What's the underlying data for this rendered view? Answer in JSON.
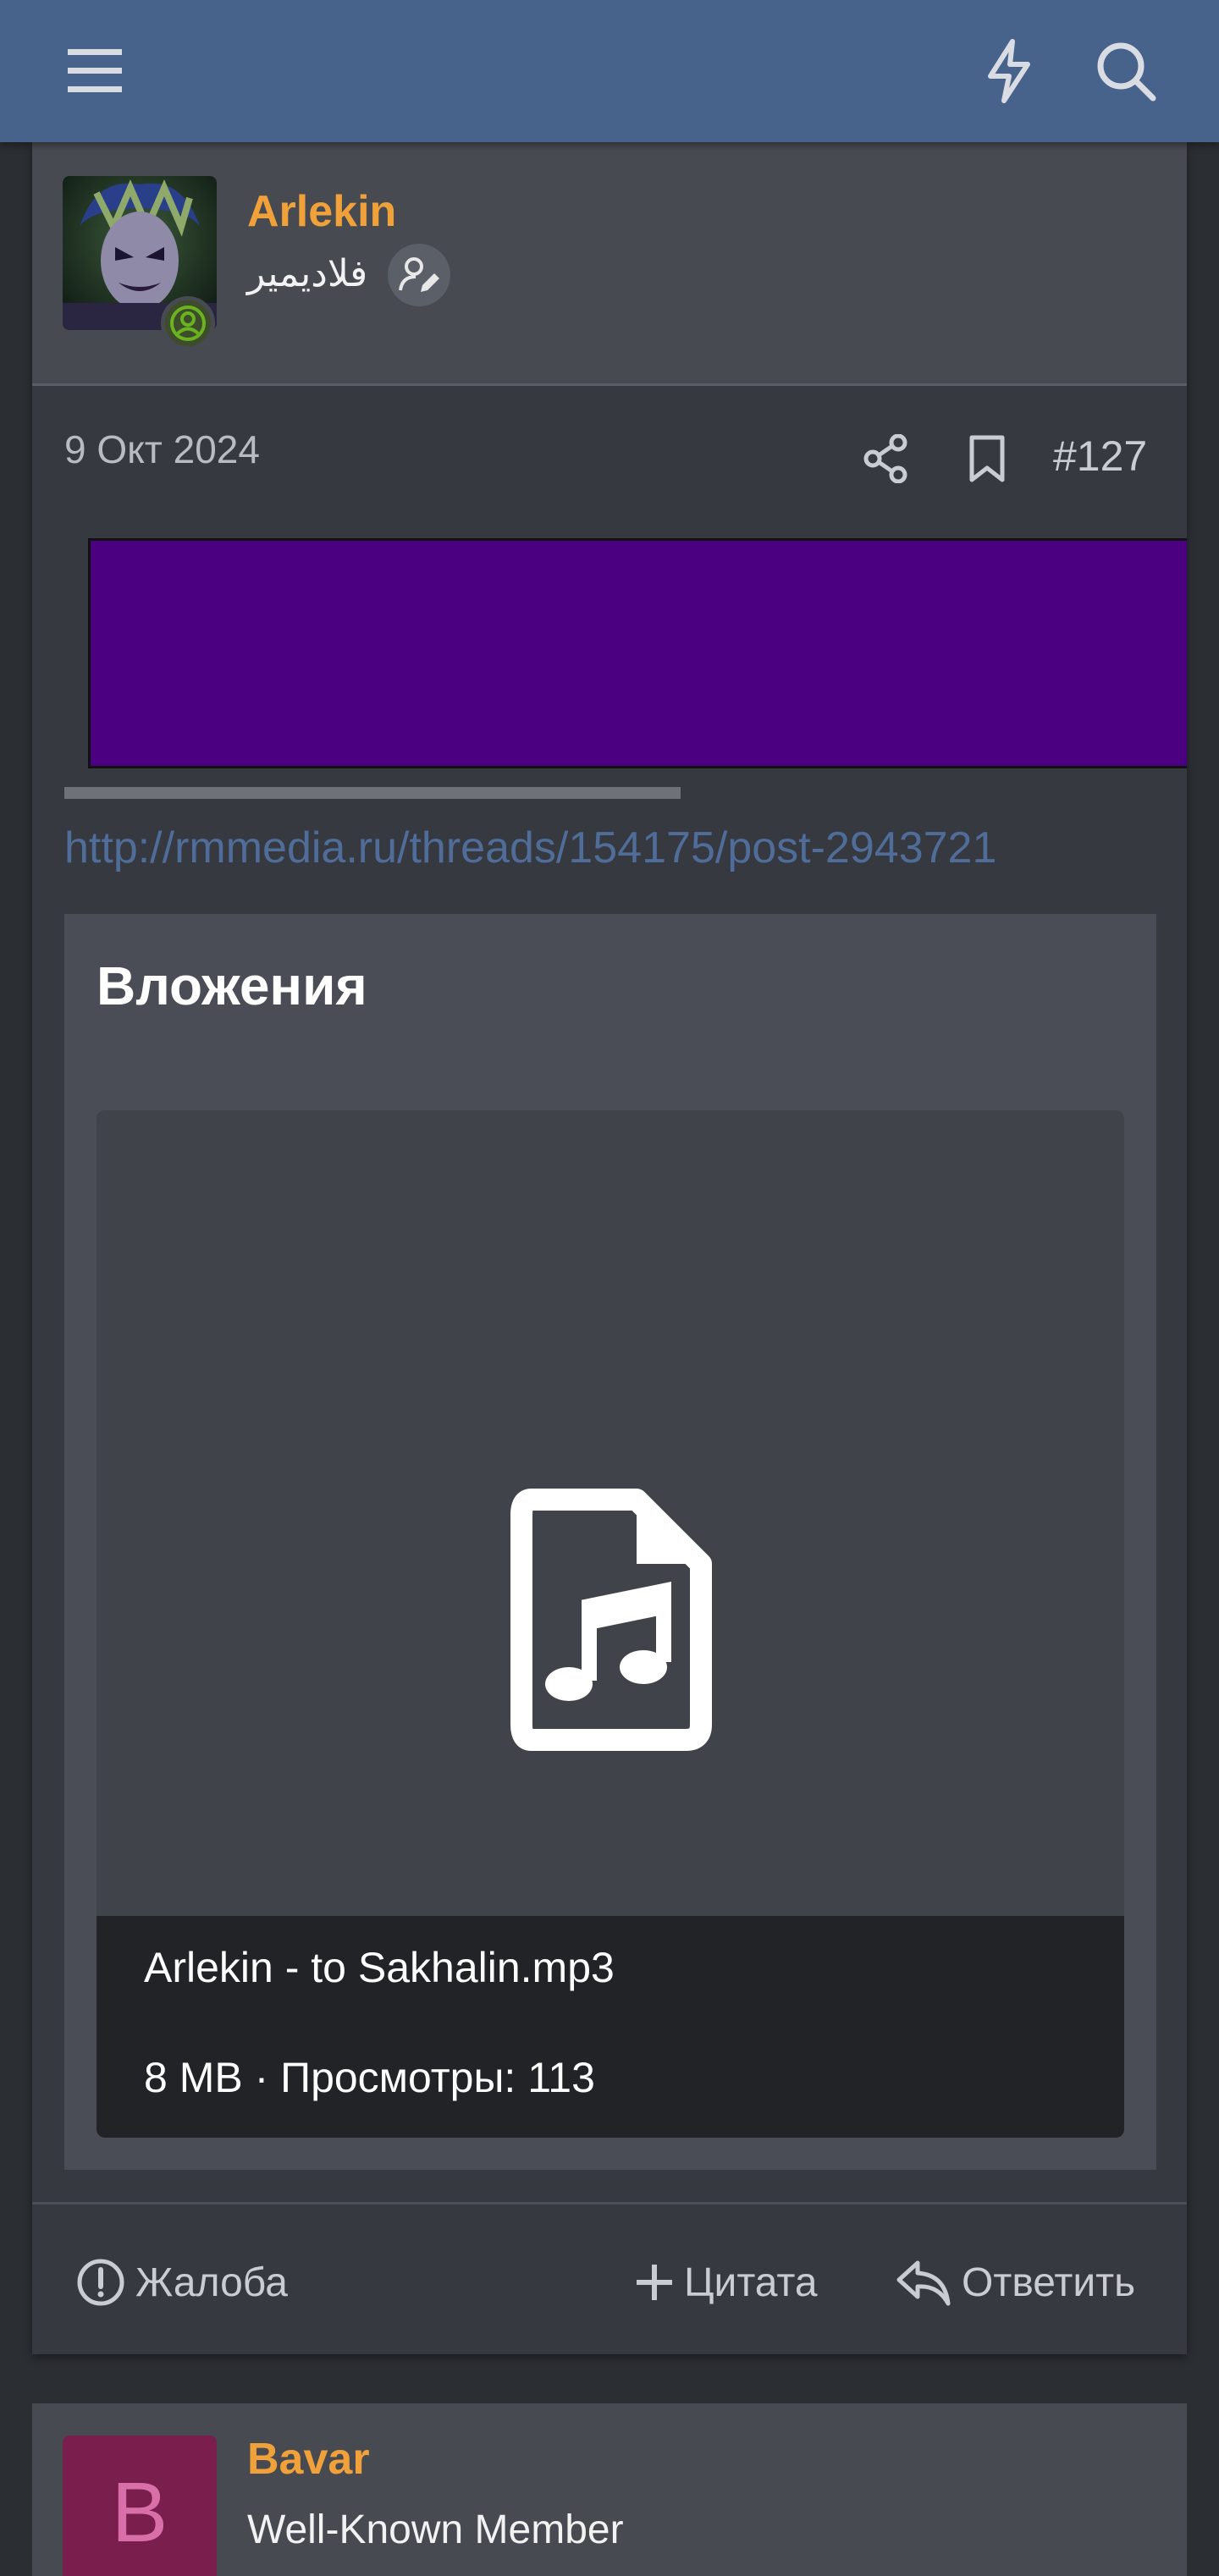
{
  "header": {
    "menu_icon": "hamburger-icon",
    "whats_new_icon": "lightning-bolt-icon",
    "search_icon": "search-icon"
  },
  "post": {
    "author": {
      "name": "Arlekin",
      "title": "فلاديمير",
      "avatar": "jester-mask-avatar",
      "online": true
    },
    "date": "9 Окт 2024",
    "number": "#127",
    "share_icon": "share-icon",
    "bookmark_icon": "bookmark-icon",
    "embed_color": "#4b0082",
    "link": "http://rmmedia.ru/threads/154175/post-2943721",
    "attachments": {
      "title": "Вложения",
      "file": {
        "icon": "audio-file-icon",
        "name": "Arlekin - to Sakhalin.mp3",
        "meta": "8 MB · Просмотры: 113"
      }
    },
    "actions": {
      "report": "Жалоба",
      "quote": "Цитата",
      "reply": "Ответить"
    }
  },
  "next_post": {
    "author": {
      "name": "Bavar",
      "title": "Well-Known Member",
      "avatar_letter": "B"
    }
  },
  "colors": {
    "header": "#47628b",
    "username": "#f0a13a",
    "link": "#4f6d98",
    "online": "#6ab21f"
  }
}
